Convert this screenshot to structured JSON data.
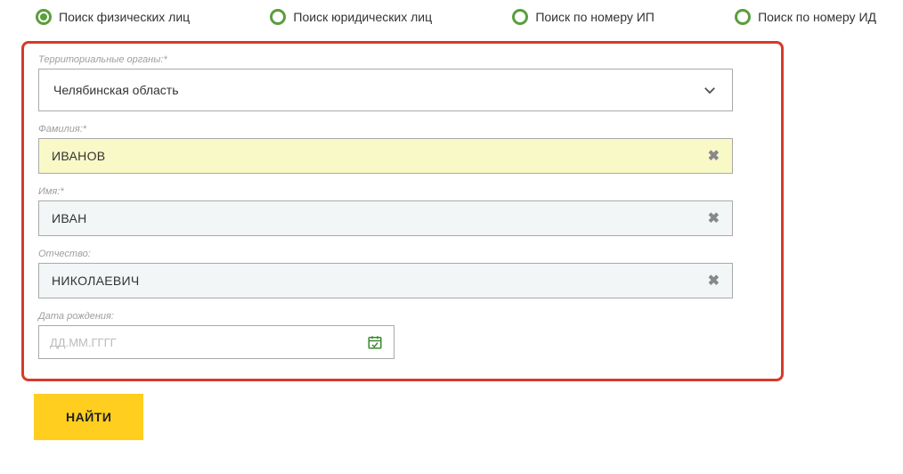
{
  "tabs": {
    "t0": "Поиск физических лиц",
    "t1": "Поиск юридических лиц",
    "t2": "Поиск по номеру ИП",
    "t3": "Поиск по номеру ИД"
  },
  "form": {
    "territory": {
      "label": "Территориальные органы:*",
      "value": "Челябинская область"
    },
    "lastname": {
      "label": "Фамилия:*",
      "value": "ИВАНОВ"
    },
    "firstname": {
      "label": "Имя:*",
      "value": "ИВАН"
    },
    "patronymic": {
      "label": "Отчество:",
      "value": "НИКОЛАЕВИЧ"
    },
    "birthdate": {
      "label": "Дата рождения:",
      "placeholder": "ДД.ММ.ГГГГ"
    }
  },
  "submit_label": "НАЙТИ"
}
